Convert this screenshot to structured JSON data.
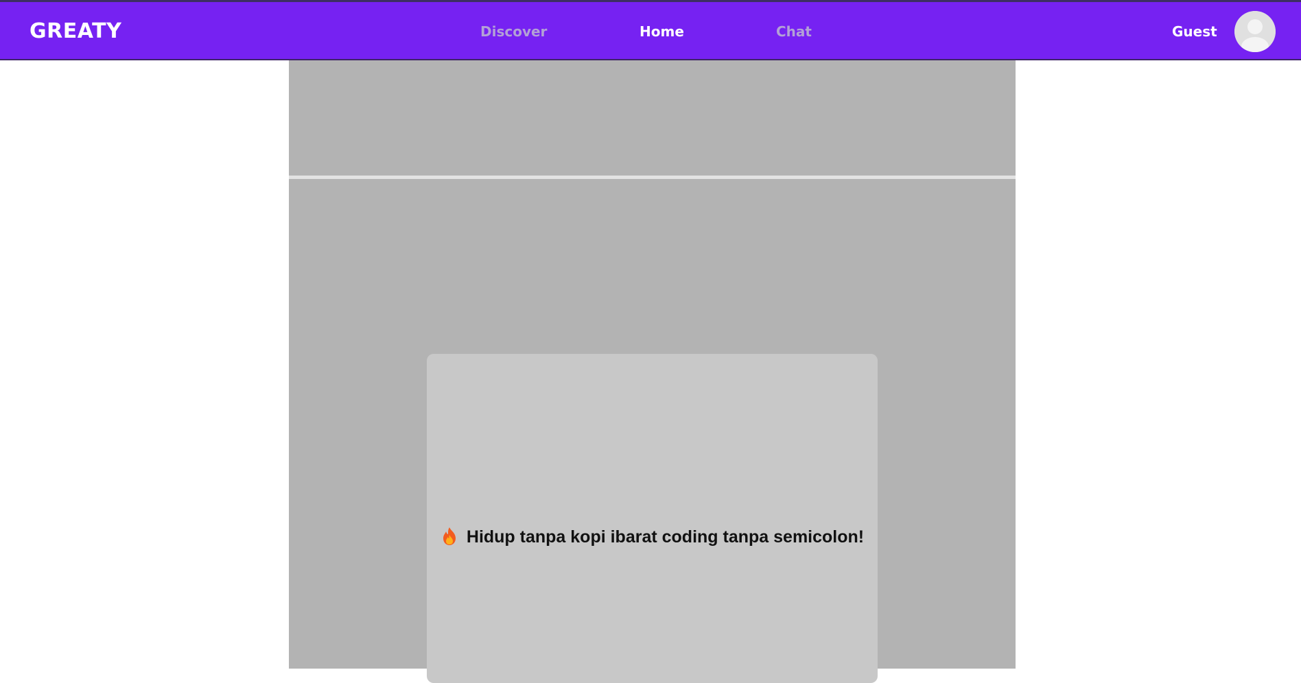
{
  "header": {
    "logo": "GREATY",
    "nav": [
      {
        "label": "Discover",
        "active": false
      },
      {
        "label": "Home",
        "active": true
      },
      {
        "label": "Chat",
        "active": false
      }
    ],
    "user_name": "Guest",
    "avatar_icon": "user-avatar-icon"
  },
  "main": {
    "post": {
      "emoji_icon": "fire-icon",
      "text": "Hidup tanpa kopi ibarat coding tanpa semicolon!"
    }
  },
  "colors": {
    "brand": "#7622f2",
    "nav_inactive": "#b3a1d6",
    "content_bg": "#b3b3b3",
    "card_bg": "#c8c8c8"
  }
}
